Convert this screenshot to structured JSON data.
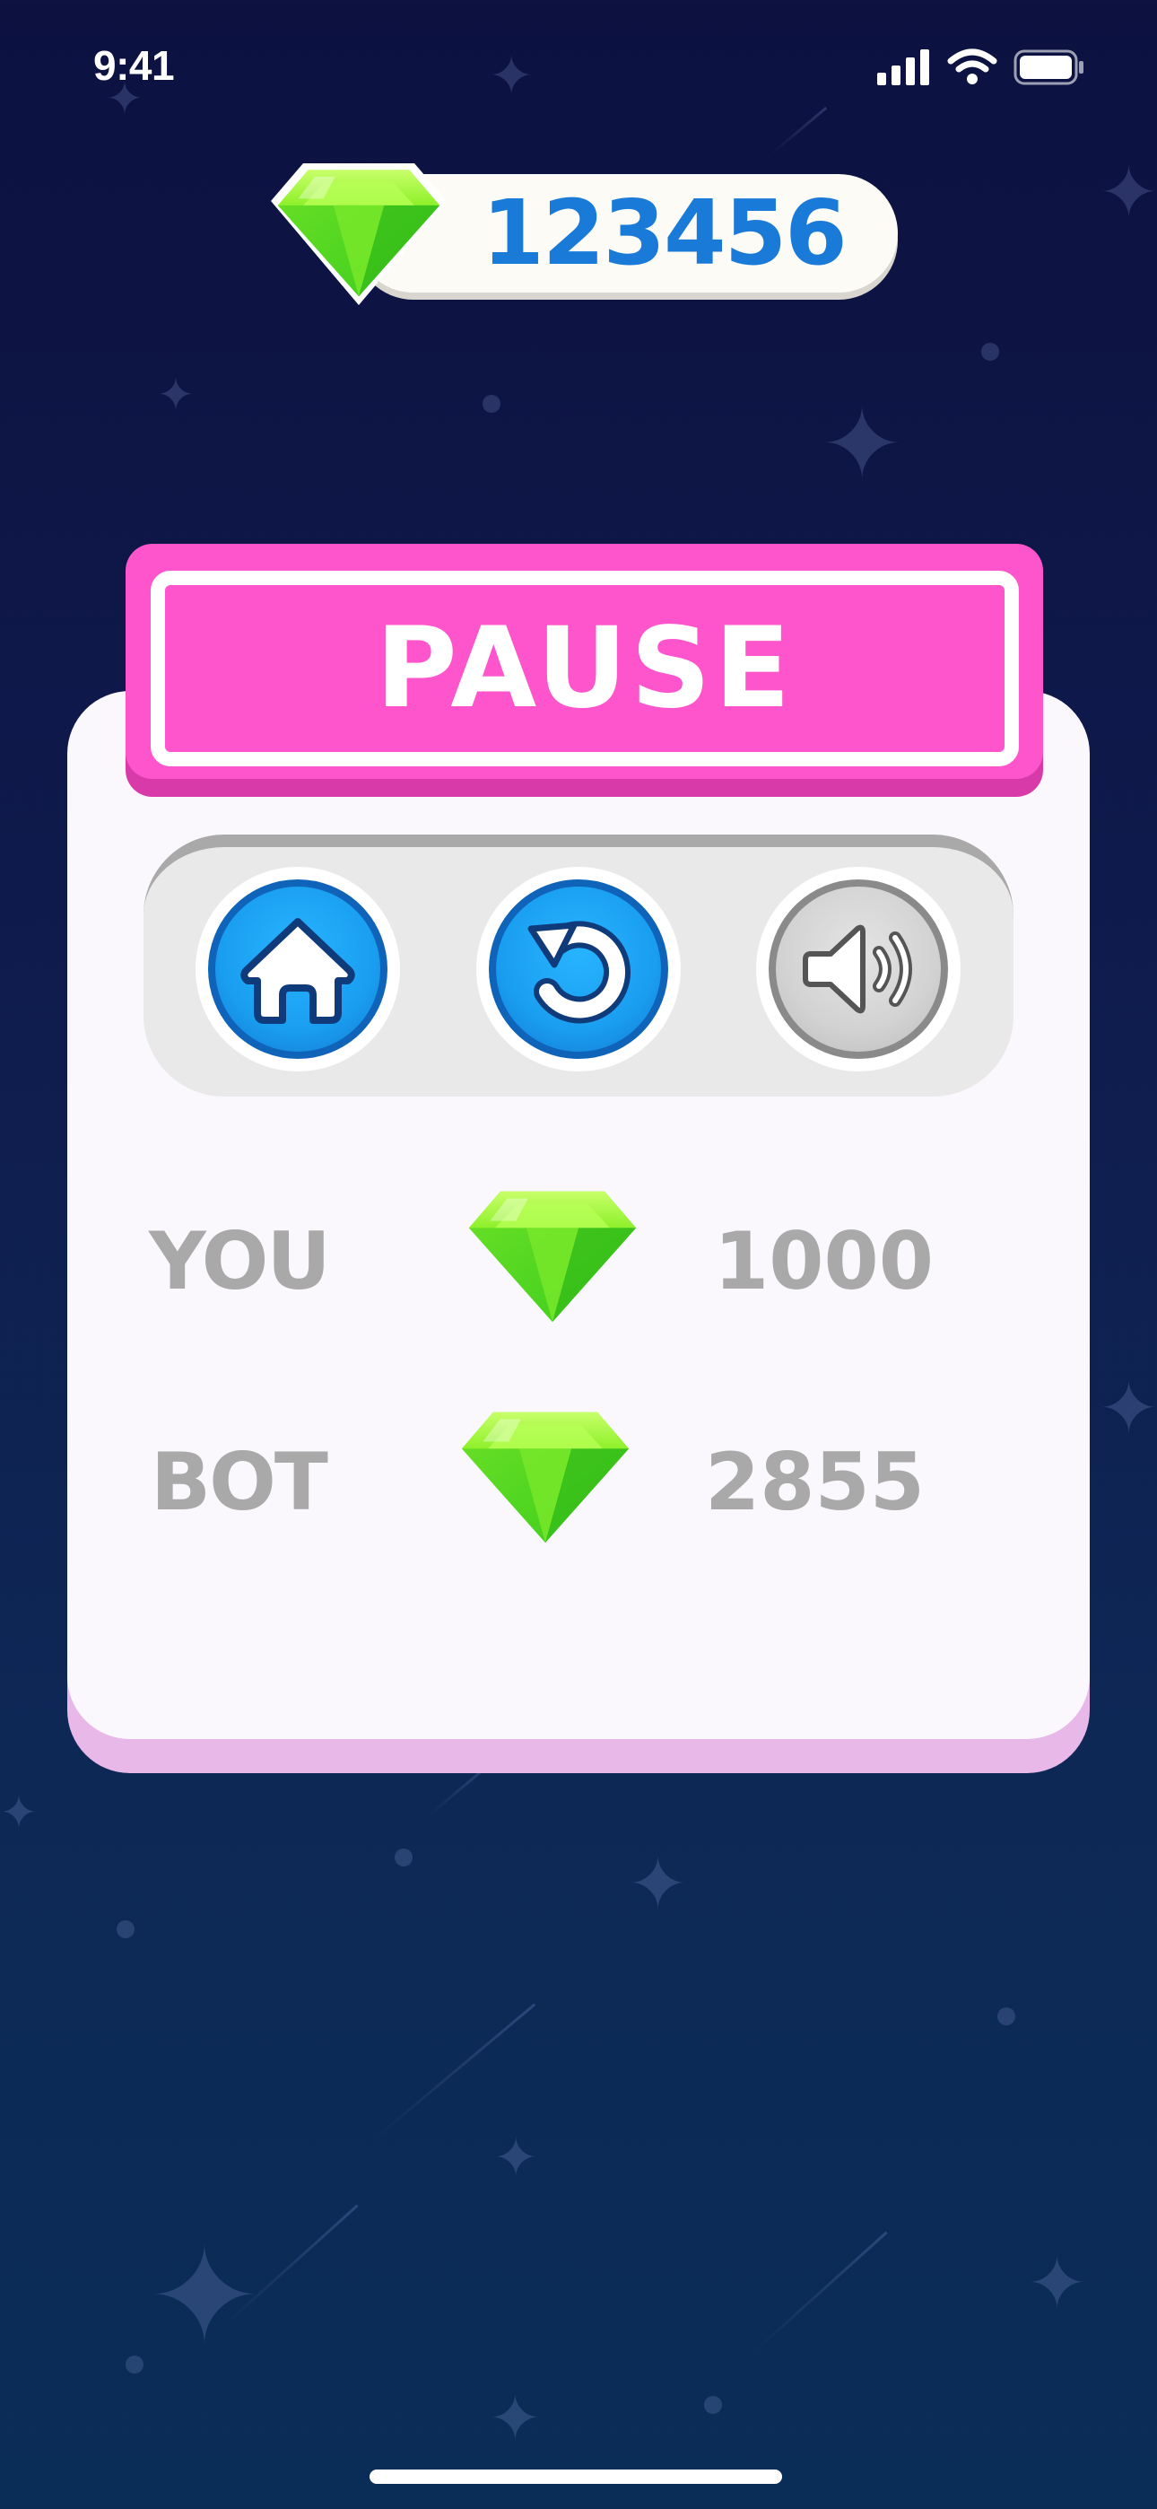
{
  "status_bar": {
    "time": "9:41"
  },
  "currency": {
    "value": "123456",
    "icon": "green-gem-icon"
  },
  "pause_panel": {
    "title": "PAUSE",
    "buttons": [
      {
        "icon": "home-icon"
      },
      {
        "icon": "restart-icon"
      },
      {
        "icon": "sound-icon"
      }
    ],
    "scores": [
      {
        "label": "YOU",
        "value": "1000",
        "icon": "green-gem-icon"
      },
      {
        "label": "BOT",
        "value": "2855",
        "icon": "green-gem-icon"
      }
    ]
  },
  "colors": {
    "banner": "#ff55cc",
    "coin_text": "#1a7ad8",
    "button_blue": "#1a9ef0",
    "score_text": "#a9a9a9"
  }
}
